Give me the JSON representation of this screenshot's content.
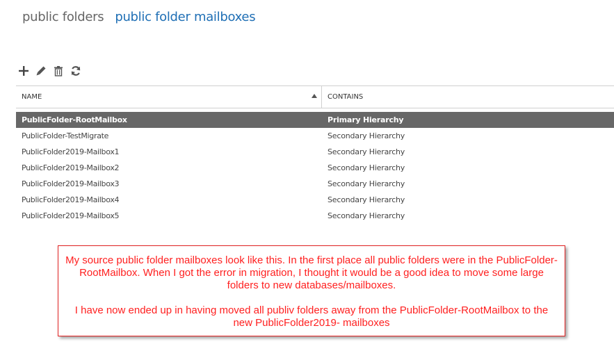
{
  "tabs": [
    {
      "label": "public folders",
      "active": false
    },
    {
      "label": "public folder mailboxes",
      "active": true
    }
  ],
  "toolbar": {
    "icons": [
      "add-icon",
      "edit-icon",
      "delete-icon",
      "refresh-icon"
    ]
  },
  "table": {
    "columns": [
      "NAME",
      "CONTAINS"
    ],
    "sort": {
      "column": "NAME",
      "direction": "ascending"
    },
    "rows": [
      {
        "name": "PublicFolder-RootMailbox",
        "contains": "Primary Hierarchy",
        "selected": true
      },
      {
        "name": "PublicFolder-TestMigrate",
        "contains": "Secondary Hierarchy",
        "selected": false
      },
      {
        "name": "PublicFolder2019-Mailbox1",
        "contains": "Secondary Hierarchy",
        "selected": false
      },
      {
        "name": "PublicFolder2019-Mailbox2",
        "contains": "Secondary Hierarchy",
        "selected": false
      },
      {
        "name": "PublicFolder2019-Mailbox3",
        "contains": "Secondary Hierarchy",
        "selected": false
      },
      {
        "name": "PublicFolder2019-Mailbox4",
        "contains": "Secondary Hierarchy",
        "selected": false
      },
      {
        "name": "PublicFolder2019-Mailbox5",
        "contains": "Secondary Hierarchy",
        "selected": false
      }
    ]
  },
  "annotation": {
    "paragraph1": "My source public folder mailboxes look like this. In the first place all public folders were in the PublicFolder-RootMailbox. When I got the error in migration, I thought it would be a good idea to move some large folders to new databases/mailboxes.",
    "paragraph2": "I have now ended up in having moved all publiv folders away from the PublicFolder-RootMailbox to the new PublicFolder2019- mailboxes",
    "color": "#ff2020"
  },
  "colors": {
    "active_tab": "#1f6fb5",
    "inactive_tab": "#666666",
    "selected_row": "#676767"
  }
}
